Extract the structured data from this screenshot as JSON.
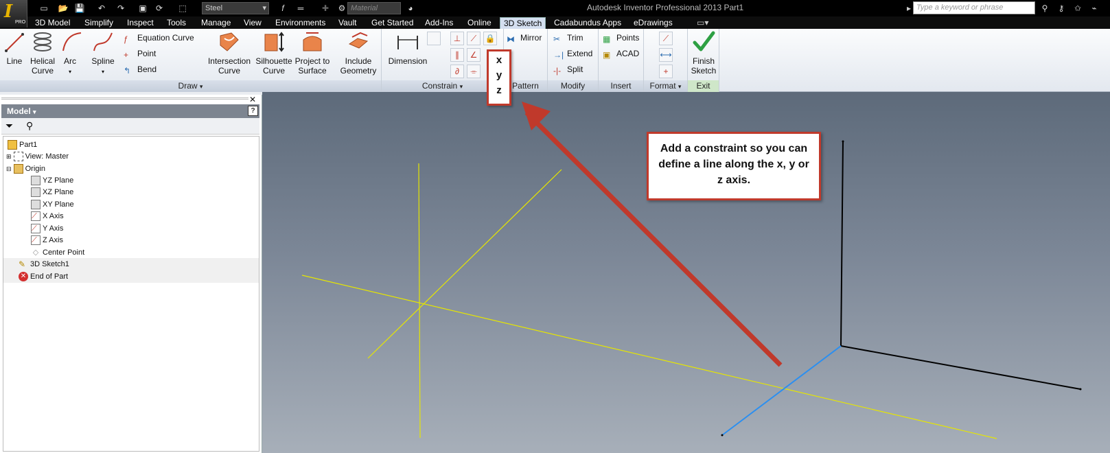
{
  "app": {
    "title": "Autodesk Inventor Professional 2013    Part1",
    "pro_badge": "PRO",
    "material_selected": "Steel",
    "appearance_placeholder": "Material",
    "search_placeholder": "Type a keyword or phrase"
  },
  "tabs": [
    "3D Model",
    "Simplify",
    "Inspect",
    "Tools",
    "Manage",
    "View",
    "Environments",
    "Vault",
    "Get Started",
    "Add-Ins",
    "Online",
    "3D Sketch",
    "Cadabundus Apps",
    "eDrawings"
  ],
  "active_tab": "3D Sketch",
  "ribbon": {
    "draw": {
      "title": "Draw",
      "line": "Line",
      "helical1": "Helical",
      "helical2": "Curve",
      "arc": "Arc",
      "spline": "Spline",
      "equation_curve": "Equation Curve",
      "point": "Point",
      "bend": "Bend",
      "intersection1": "Intersection",
      "intersection2": "Curve",
      "silhouette1": "Silhouette",
      "silhouette2": "Curve",
      "project1": "Project to",
      "project2": "Surface",
      "include1": "Include",
      "include2": "Geometry"
    },
    "constrain": {
      "title": "Constrain",
      "dimension": "Dimension"
    },
    "pattern": {
      "title": "Pattern",
      "mirror": "Mirror"
    },
    "modify": {
      "title": "Modify",
      "trim": "Trim",
      "extend": "Extend",
      "split": "Split"
    },
    "insert": {
      "title": "Insert",
      "points": "Points",
      "acad": "ACAD"
    },
    "format": {
      "title": "Format"
    },
    "exit": {
      "title": "Exit",
      "finish1": "Finish",
      "finish2": "Sketch"
    }
  },
  "browser": {
    "title": "Model",
    "tree": [
      "Part1",
      "View: Master",
      "Origin",
      "YZ Plane",
      "XZ Plane",
      "XY Plane",
      "X Axis",
      "Y Axis",
      "Z Axis",
      "Center Point",
      "3D Sketch1",
      "End of Part"
    ]
  },
  "callouts": {
    "axes": [
      "x",
      "y",
      "z"
    ],
    "tip": "Add a constraint so you can define a line along the x, y or z axis."
  },
  "colors": {
    "callout_border": "#c0392b",
    "sketch_yellow": "#e6e600",
    "blue_line": "#2b8ff0",
    "finish_green": "#2ea043"
  }
}
